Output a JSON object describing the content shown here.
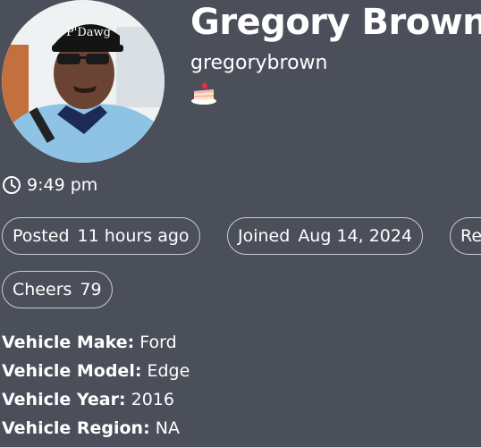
{
  "profile": {
    "name": "Gregory Brown",
    "username": "gregorybrown",
    "cake_icon": "cake-day-icon",
    "avatar_icon": "user-avatar-photo"
  },
  "local_time": {
    "icon": "clock-icon",
    "value": "9:49 pm"
  },
  "stats": {
    "posted_label": "Posted",
    "posted_value": "11 hours ago",
    "joined_label": "Joined",
    "joined_value": "Aug 14, 2024",
    "read_label": "Re",
    "cheers_label": "Cheers",
    "cheers_value": "79"
  },
  "fields": [
    {
      "label": "Vehicle Make:",
      "value": "Ford"
    },
    {
      "label": "Vehicle Model:",
      "value": "Edge"
    },
    {
      "label": "Vehicle Year:",
      "value": "2016"
    },
    {
      "label": "Vehicle Region:",
      "value": "NA"
    }
  ]
}
